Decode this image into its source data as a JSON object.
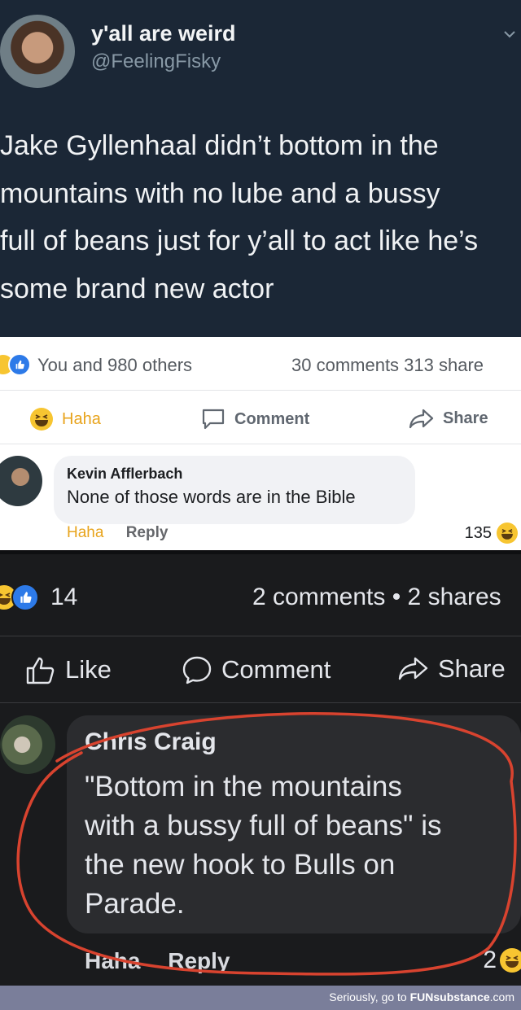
{
  "tweet": {
    "display_name": "y'all are weird",
    "handle": "@FeelingFisky",
    "text": "Jake Gyllenhaal didn’t bottom in the\nmountains with no lube and a bussy\nfull of beans just for y’all to act like he’s\nsome brand new actor"
  },
  "fb_post_1": {
    "reactors": "You and 980 others",
    "counts": "30 comments  313 share",
    "actions": {
      "haha": "Haha",
      "comment": "Comment",
      "share": "Share"
    },
    "comment": {
      "author": "Kevin Afflerbach",
      "text": "None of those words are in the Bible",
      "haha": "Haha",
      "reply": "Reply",
      "reaction_count": "135"
    }
  },
  "fb_post_2": {
    "reaction_count": "14",
    "counts": "2 comments • 2 shares",
    "actions": {
      "like": "Like",
      "comment": "Comment",
      "share": "Share"
    },
    "comment": {
      "author": "Chris Craig",
      "text": "\"Bottom in the mountains\nwith a bussy full of beans\" is\nthe new hook to Bulls on\nParade.",
      "haha": "Haha",
      "reply": "Reply",
      "reaction_count": "2"
    }
  },
  "watermark": {
    "prefix": "Seriously, go to ",
    "brand": "FUNsubstance",
    "suffix": ".com"
  },
  "colors": {
    "tweet_bg": "#1b2736",
    "haha": "#f7c531",
    "like": "#2d7ae8",
    "annotation": "#d8432f"
  }
}
